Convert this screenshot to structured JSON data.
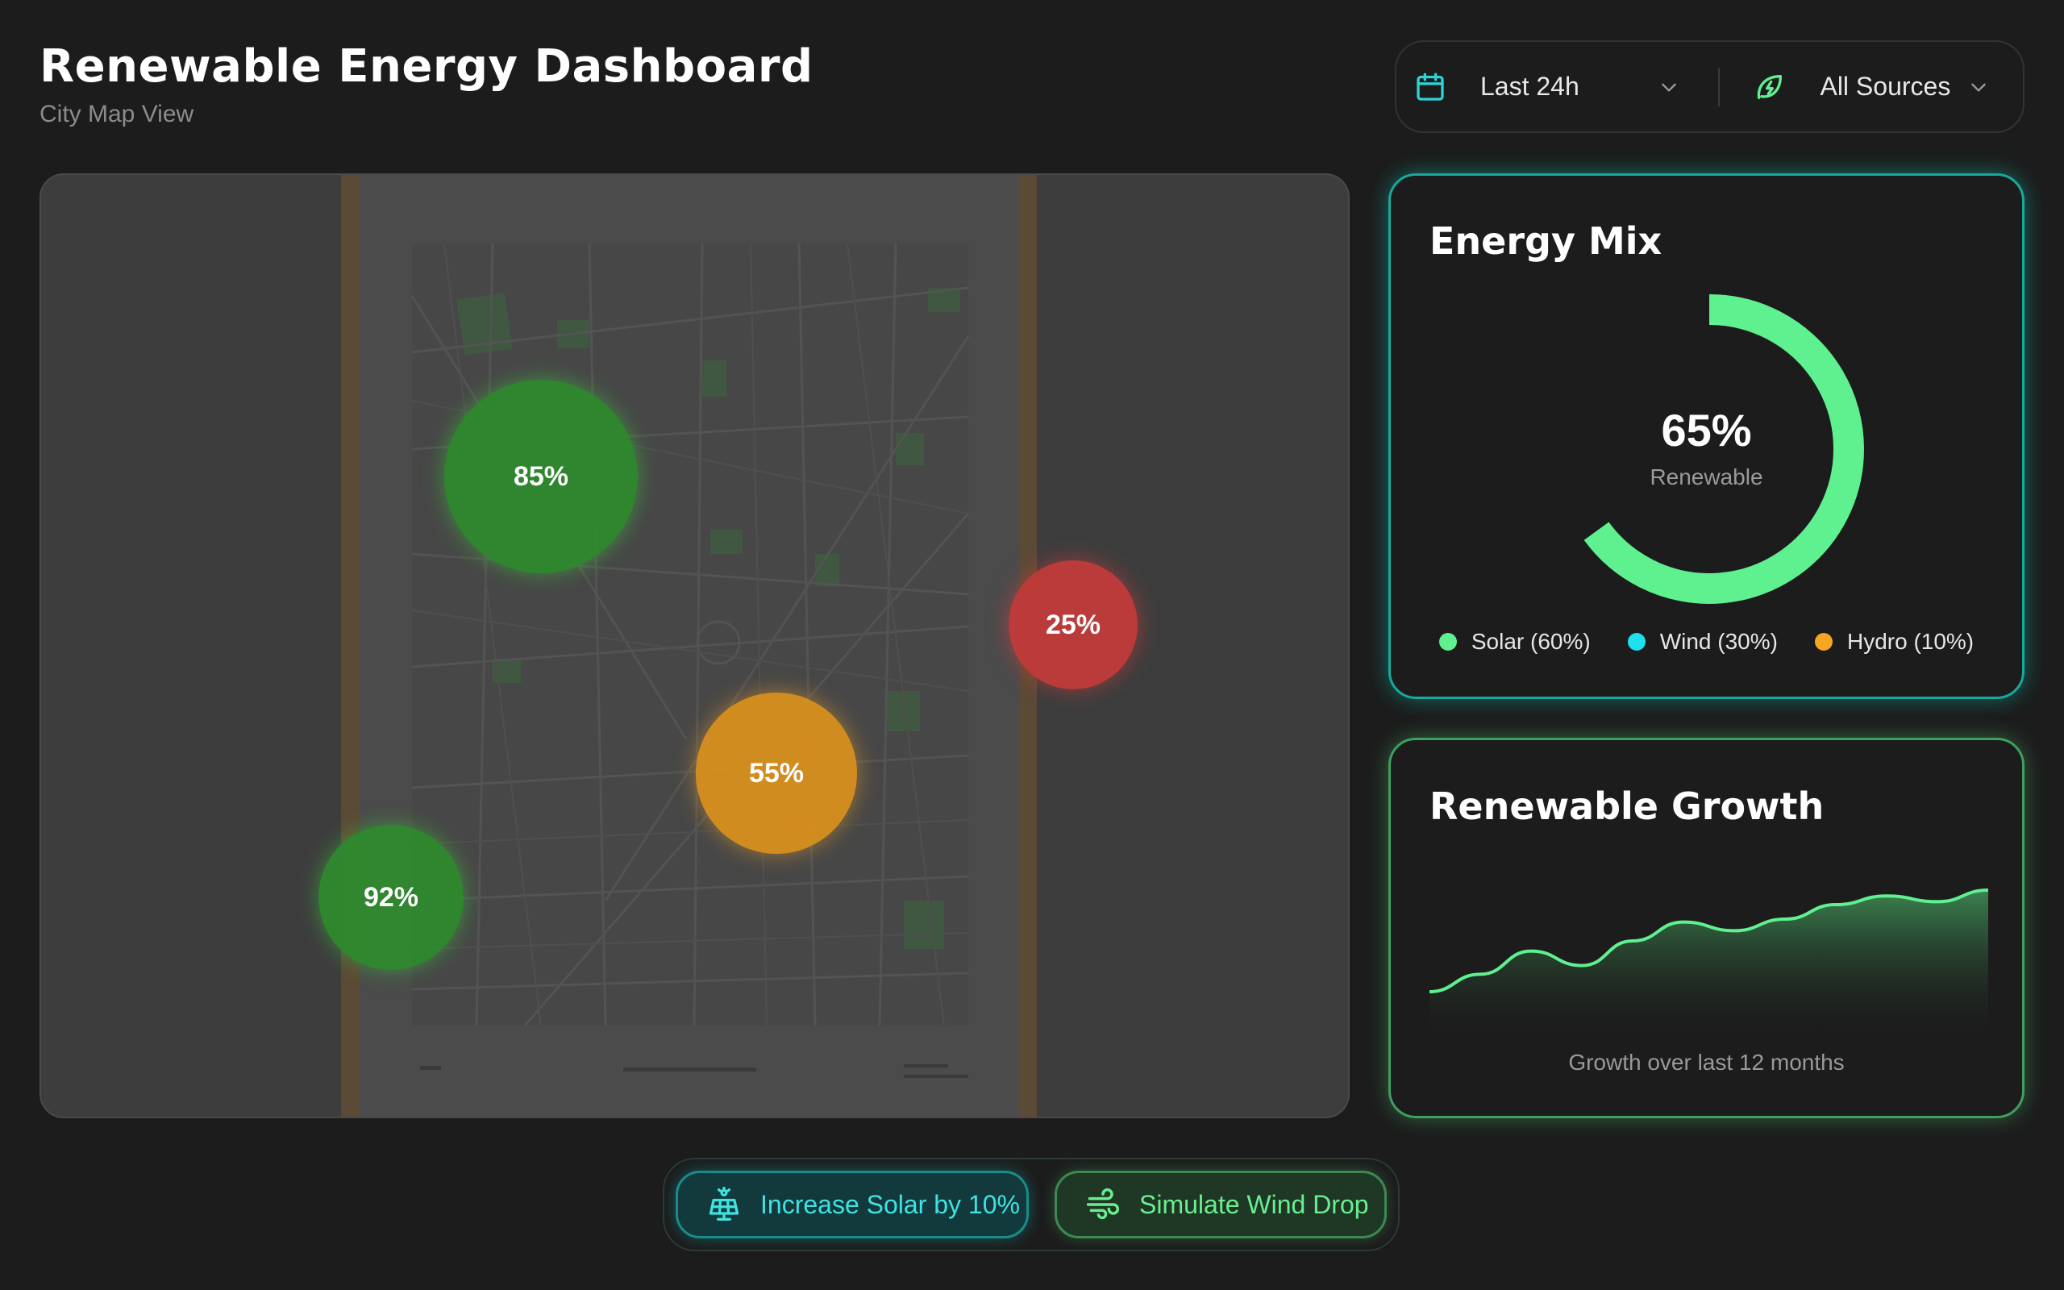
{
  "header": {
    "title": "Renewable Energy Dashboard",
    "subtitle": "City Map View"
  },
  "filters": {
    "date": {
      "icon": "calendar-icon",
      "value": "Last 24h"
    },
    "source": {
      "icon": "leaf-bolt-icon",
      "value": "All Sources"
    }
  },
  "map": {
    "zones": [
      {
        "label": "85%",
        "value": 85,
        "status_color": "#2e8c2e"
      },
      {
        "label": "25%",
        "value": 25,
        "status_color": "#c23a3a"
      },
      {
        "label": "55%",
        "value": 55,
        "status_color": "#d9901f"
      },
      {
        "label": "92%",
        "value": 92,
        "status_color": "#2e8c2e"
      }
    ]
  },
  "energy_mix": {
    "title": "Energy Mix",
    "center_value": "65%",
    "center_label": "Renewable",
    "renewable_fraction": 0.65,
    "legend": [
      {
        "label": "Solar (60%)",
        "color": "#5ff08f"
      },
      {
        "label": "Wind (30%)",
        "color": "#1ee0f0"
      },
      {
        "label": "Hydro (10%)",
        "color": "#f5a623"
      }
    ]
  },
  "growth": {
    "title": "Renewable Growth",
    "caption": "Growth over last 12 months"
  },
  "chart_data": {
    "type": "area",
    "title": "Renewable Growth",
    "xlabel": "",
    "ylabel": "",
    "grid": false,
    "x": [
      1,
      2,
      3,
      4,
      5,
      6,
      7,
      8,
      9,
      10,
      11,
      12
    ],
    "series": [
      {
        "values": [
          10,
          22,
          38,
          28,
          45,
          58,
          52,
          60,
          70,
          76,
          72,
          80
        ]
      }
    ],
    "ylim": [
      0,
      100
    ],
    "color": "#5ff08f"
  },
  "actions": {
    "solar": {
      "icon": "solar-panel-icon",
      "label": "Increase Solar by 10%"
    },
    "wind": {
      "icon": "wind-icon",
      "label": "Simulate Wind Drop"
    }
  },
  "colors": {
    "background": "#1c1c1c",
    "accent_green": "#5ff08f",
    "accent_cyan": "#1ee0f0"
  }
}
